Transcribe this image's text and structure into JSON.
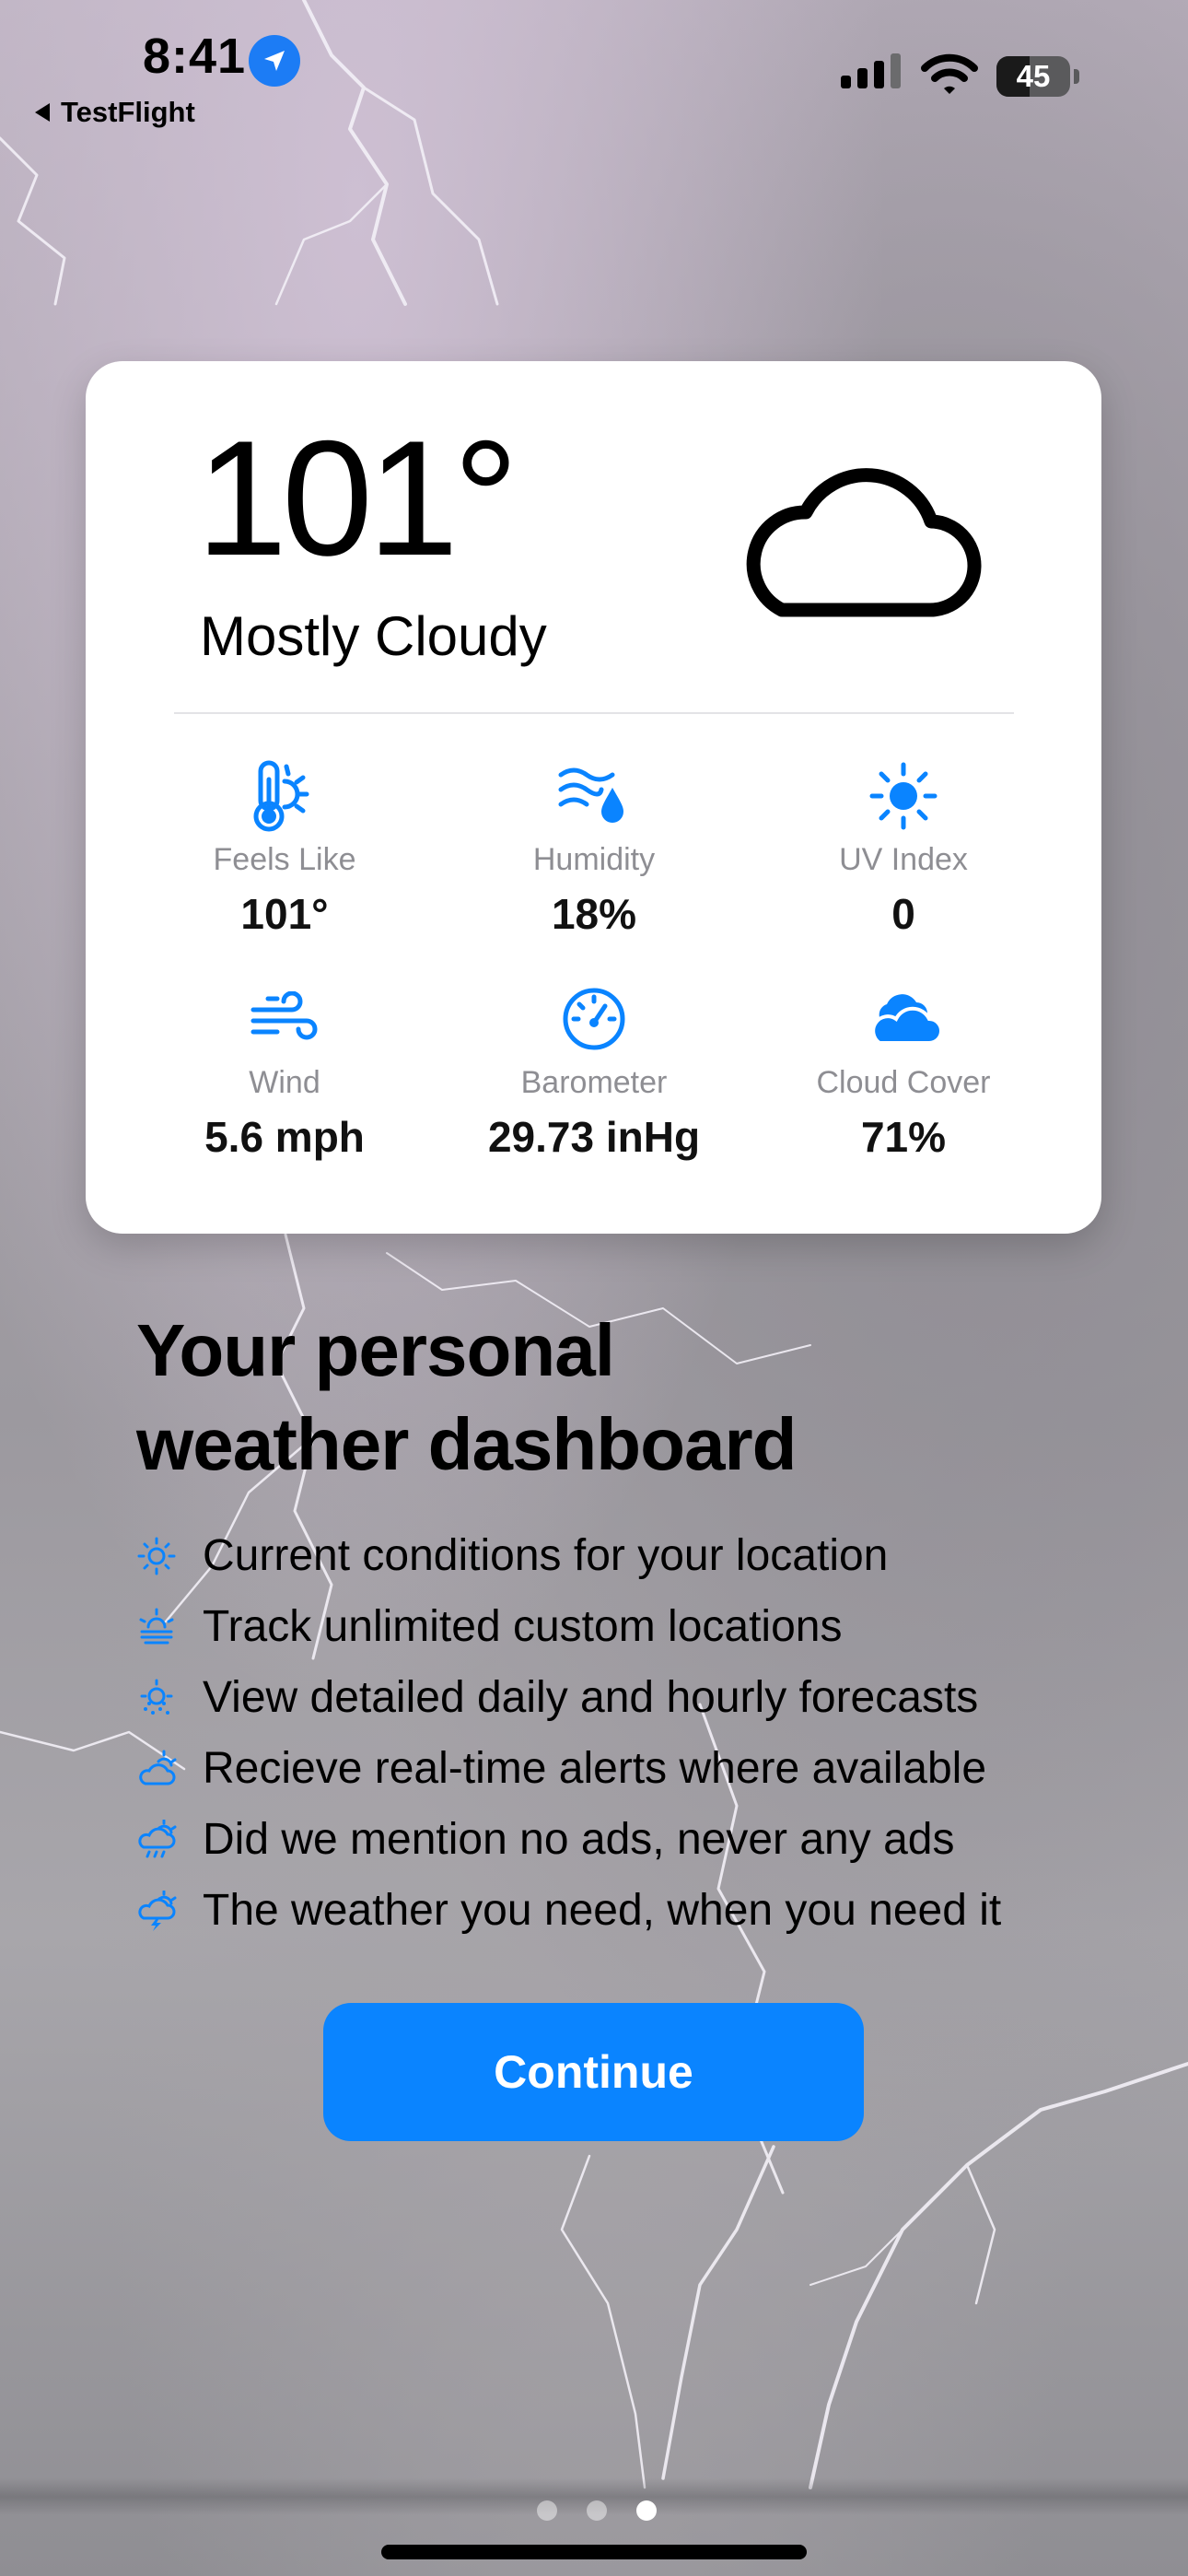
{
  "status_bar": {
    "time": "8:41",
    "back_app": "TestFlight",
    "battery": "45",
    "battery_level": 0.45,
    "icons": [
      "location-arrow-icon",
      "signal-icon",
      "wifi-icon",
      "battery-icon"
    ]
  },
  "weather_card": {
    "temperature": "101°",
    "condition": "Mostly Cloudy",
    "condition_icon": "cloud-icon",
    "metrics": [
      {
        "label": "Feels Like",
        "value": "101°",
        "icon": "thermometer-sun-icon"
      },
      {
        "label": "Humidity",
        "value": "18%",
        "icon": "humidity-icon"
      },
      {
        "label": "UV Index",
        "value": "0",
        "icon": "sun-icon"
      },
      {
        "label": "Wind",
        "value": "5.6 mph",
        "icon": "wind-icon"
      },
      {
        "label": "Barometer",
        "value": "29.73 inHg",
        "icon": "gauge-icon"
      },
      {
        "label": "Cloud Cover",
        "value": "71%",
        "icon": "clouds-icon"
      }
    ]
  },
  "headline": {
    "line1": "Your personal",
    "line2": "weather dashboard"
  },
  "features": [
    {
      "text": "Current conditions for your location",
      "icon": "sun-icon"
    },
    {
      "text": "Track unlimited custom locations",
      "icon": "sun-haze-icon"
    },
    {
      "text": "View detailed daily and hourly forecasts",
      "icon": "sun-dust-icon"
    },
    {
      "text": "Recieve real-time alerts where available",
      "icon": "cloud-sun-icon"
    },
    {
      "text": "Did we mention no ads, never any ads",
      "icon": "cloud-sun-rain-icon"
    },
    {
      "text": "The weather you need, when you need it",
      "icon": "cloud-sun-bolt-icon"
    }
  ],
  "continue_label": "Continue",
  "page_indicator": {
    "count": 3,
    "current": 3
  },
  "colors": {
    "accent": "#0a84ff",
    "card": "#ffffff",
    "label": "#8e8e93"
  }
}
